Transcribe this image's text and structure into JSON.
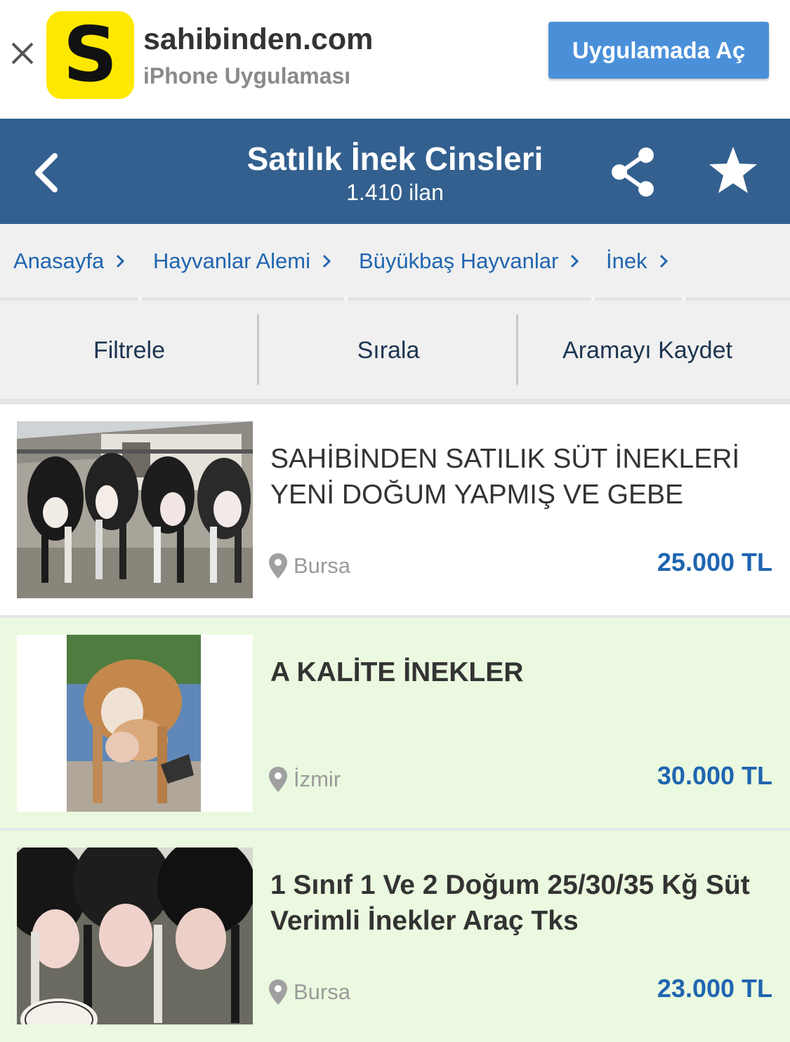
{
  "banner": {
    "app_name": "sahibinden.com",
    "app_subtitle": "iPhone Uygulaması",
    "logo_letter": "S",
    "open_button": "Uygulamada Aç",
    "logo_color": "#ffe800",
    "button_color": "#4a90d9"
  },
  "header": {
    "title": "Satılık İnek Cinsleri",
    "count": "1.410 ilan",
    "bg_color": "#33608f"
  },
  "breadcrumb": [
    {
      "label": "Anasayfa"
    },
    {
      "label": "Hayvanlar Alemi"
    },
    {
      "label": "Büyükbaş Hayvanlar"
    },
    {
      "label": "İnek"
    }
  ],
  "toolbar": {
    "filter": "Filtrele",
    "sort": "Sırala",
    "save_search": "Aramayı Kaydet"
  },
  "listings": [
    {
      "title": "SAHİBİNDEN SATILIK SÜT İNEKLERİ YENİ DOĞUM YAPMIŞ VE GEBE",
      "location": "Bursa",
      "price": "25.000 TL",
      "highlighted": false
    },
    {
      "title": "A KALİTE İNEKLER",
      "location": "İzmir",
      "price": "30.000 TL",
      "highlighted": true
    },
    {
      "title": "1 Sınıf 1 Ve 2 Doğum 25/30/35 Kğ Süt Verimli İnekler Araç Tks",
      "location": "Bursa",
      "price": "23.000 TL",
      "highlighted": true
    }
  ],
  "colors": {
    "link_blue": "#1f65b0",
    "highlight_bg": "#eaf9df"
  }
}
